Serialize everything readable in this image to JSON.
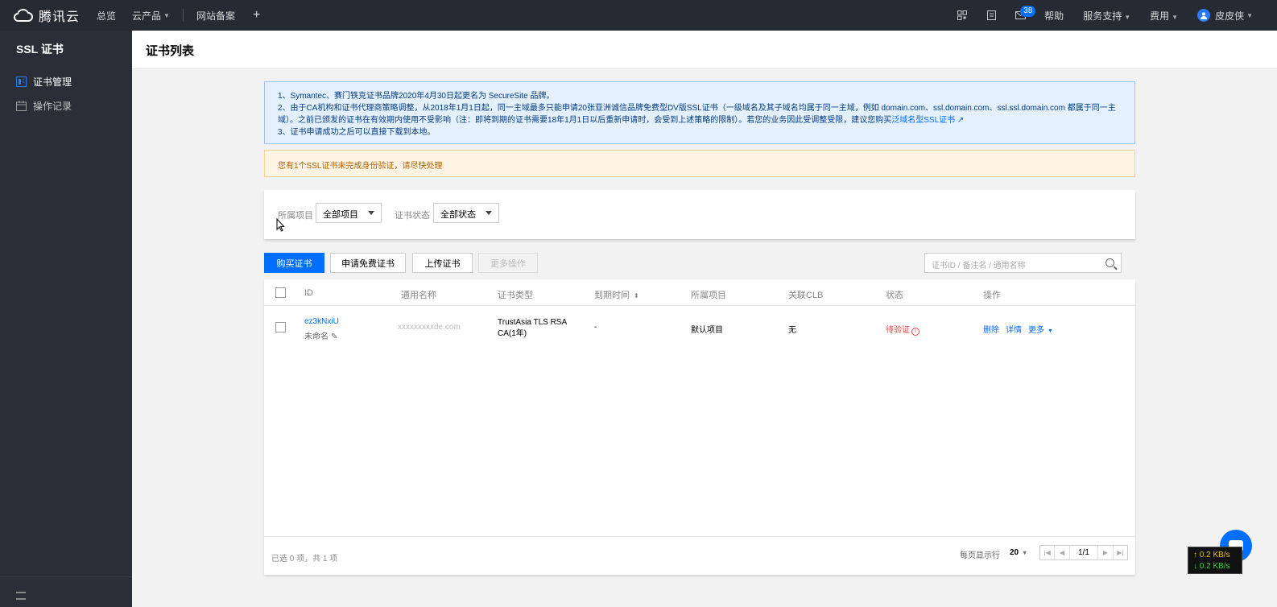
{
  "topbar": {
    "logo_text": "腾讯云",
    "nav": [
      {
        "label": "总览"
      },
      {
        "label": "云产品",
        "has_dropdown": true
      },
      {
        "label": "网站备案"
      }
    ],
    "add_icon": "plus-icon",
    "right": {
      "mail_badge": "38",
      "help": "帮助",
      "support": "服务支持",
      "billing": "费用",
      "user": "皮皮侠"
    }
  },
  "sidebar": {
    "title": "SSL 证书",
    "items": [
      {
        "label": "证书管理",
        "icon": "certificate-icon",
        "active": true
      },
      {
        "label": "操作记录",
        "icon": "calendar-icon",
        "active": false
      }
    ]
  },
  "page": {
    "title": "证书列表"
  },
  "notice_blue": {
    "line1": "1、Symantec、赛门铁克证书品牌2020年4月30日起更名为 SecureSite 品牌。",
    "line2": "2、由于CA机构和证书代理商策略调整，从2018年1月1日起，同一主域最多只能申请20张亚洲诚信品牌免费型DV版SSL证书（一级域名及其子域名均属于同一主域，例如 domain.com、ssl.domain.com、ssl.ssl.domain.com 都属于同一主",
    "line3": "域）。之前已颁发的证书在有效期内使用不受影响（注：即将到期的证书需要18年1月1日以后重新申请时，会受到上述策略的限制）。若您的业务因此受调整受限，建议您购买",
    "line3_link": "泛域名型SSL证书",
    "line4": "3、证书申请成功之后可以直接下载到本地。"
  },
  "notice_orange": {
    "text": "您有1个SSL证书未完成身份验证，请尽快处理"
  },
  "filters": {
    "project_label": "所属项目",
    "project_value": "全部项目",
    "status_label": "证书状态",
    "status_value": "全部状态"
  },
  "toolbar": {
    "buy": "购买证书",
    "apply_free": "申请免费证书",
    "upload": "上传证书",
    "more": "更多操作",
    "search_placeholder": "证书ID / 备注名 / 通用名称"
  },
  "table": {
    "headers": {
      "id": "ID",
      "name": "通用名称",
      "type": "证书类型",
      "expire": "到期时间",
      "project": "所属项目",
      "clb": "关联CLB",
      "status": "状态",
      "actions": "操作"
    },
    "rows": [
      {
        "id": "ez3kNxiU",
        "remark": "未命名",
        "name": "xxxxxxxxxde.com",
        "type": "TrustAsia TLS RSA CA(1年)",
        "expire": "-",
        "project": "默认项目",
        "clb": "无",
        "status": "待验证",
        "act_delete": "删除",
        "act_detail": "详情",
        "act_more": "更多"
      }
    ],
    "footer": {
      "total": "已选 0 项，共 1 项",
      "page_size_label": "每页显示行",
      "page_size": "20",
      "page": "1/1"
    }
  },
  "speed_widget": {
    "up": "↑ 0.2 KB/s",
    "down": "↓ 0.2 KB/s"
  }
}
